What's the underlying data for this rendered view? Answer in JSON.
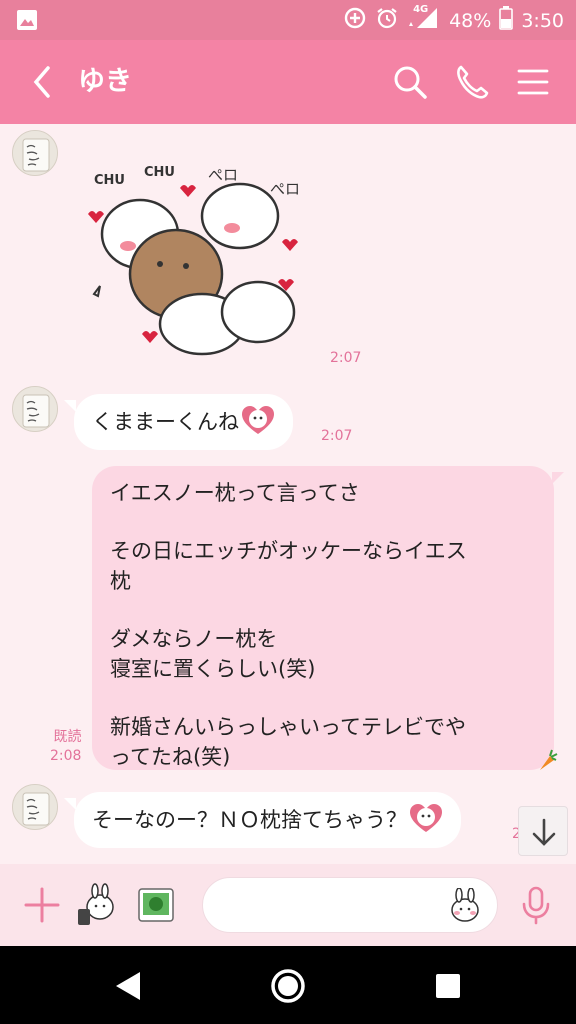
{
  "status_bar": {
    "network": "4G",
    "battery": "48%",
    "time": "3:50"
  },
  "header": {
    "title": "ゆき"
  },
  "messages": {
    "sticker_time": "2:07",
    "msg1_text": "くままーくんね",
    "msg1_time": "2:07",
    "outgoing": {
      "lines": [
        "イエスノー枕って言ってさ",
        "その日にエッチがオッケーならイエス",
        "枕",
        "ダメならノー枕を",
        "寝室に置くらしい(笑)",
        "新婚さんいらっしゃいってテレビでや",
        "ってたね(笑)"
      ],
      "read_label": "既読",
      "time": "2:08"
    },
    "msg3_text": "そーなのー？ＮＯ枕捨てちゃう？",
    "msg3_time": "2"
  },
  "colors": {
    "accent": "#f483a5",
    "outgoing_bubble": "#fcd7e3",
    "background": "#fdeff2"
  },
  "icons": [
    "image-icon",
    "data-saver-icon",
    "alarm-icon",
    "signal-icon",
    "battery-icon",
    "back-icon",
    "search-icon",
    "phone-icon",
    "menu-icon",
    "plus-icon",
    "sticker-icon",
    "photo-icon",
    "emoji-icon",
    "mic-icon",
    "arrow-down-icon",
    "nav-back-icon",
    "nav-home-icon",
    "nav-recents-icon"
  ]
}
